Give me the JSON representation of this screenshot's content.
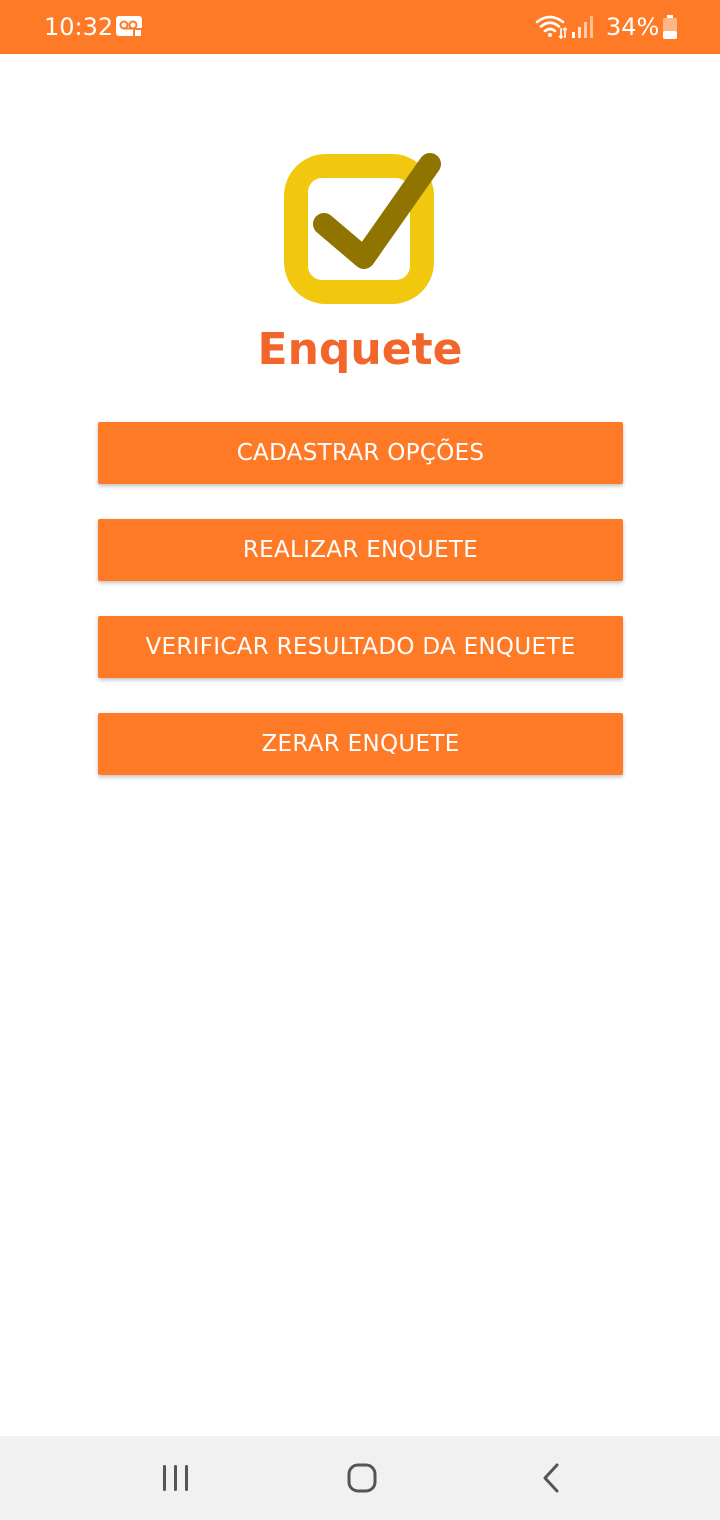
{
  "status_bar": {
    "time": "10:32",
    "battery": "34%",
    "icons": [
      "voicemail-icon",
      "wifi-icon",
      "signal-icon",
      "battery-icon"
    ],
    "background_color": "#ff7a26"
  },
  "app": {
    "title": "Enquete",
    "logo": "checkbox-check-logo",
    "title_color": "#f2662b"
  },
  "menu": {
    "buttons": [
      {
        "label": "CADASTRAR OPÇÕES"
      },
      {
        "label": "REALIZAR ENQUETE"
      },
      {
        "label": "VERIFICAR RESULTADO DA ENQUETE"
      },
      {
        "label": "ZERAR ENQUETE"
      }
    ],
    "button_color": "#ff7a26"
  },
  "nav_bar": {
    "icons": [
      "recents-icon",
      "home-icon",
      "back-icon"
    ]
  }
}
